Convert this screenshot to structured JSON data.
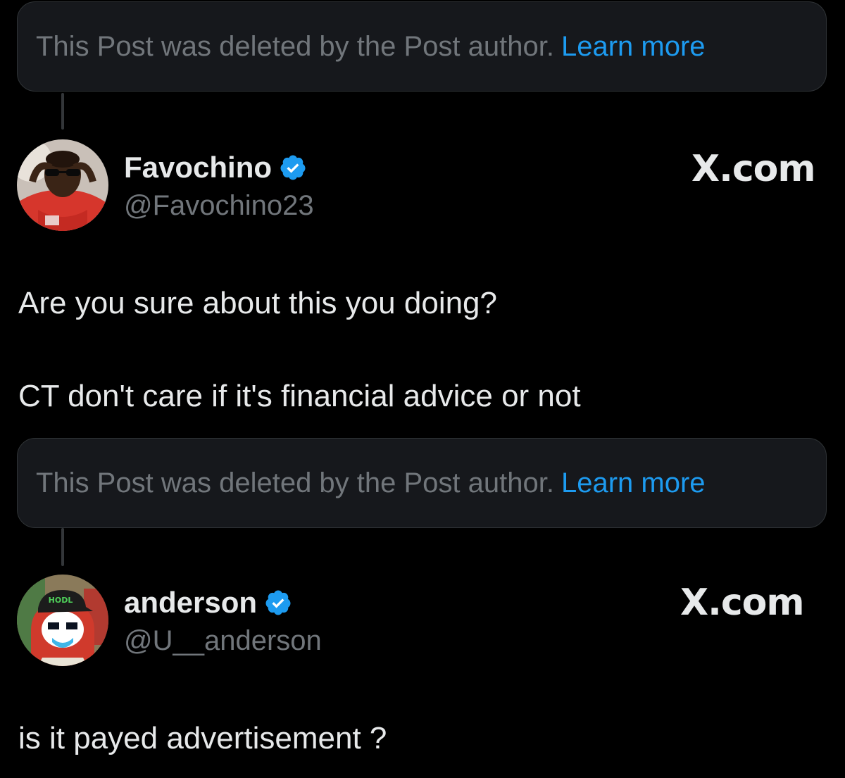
{
  "deleted_notice": {
    "text": "This Post was deleted by the Post author.",
    "link": "Learn more"
  },
  "posts": [
    {
      "display_name": "Favochino",
      "handle": "@Favochino23",
      "brand": "X.com",
      "verified": true,
      "lines": [
        "Are you sure about this you doing?",
        "CT don't care if it's financial advice or not"
      ]
    },
    {
      "display_name": "anderson",
      "handle": "@U__anderson",
      "brand": "X.com",
      "verified": true,
      "cap_text": "HODL",
      "lines": [
        "is it payed advertisement ?"
      ]
    }
  ],
  "colors": {
    "background": "#000000",
    "card": "#16181c",
    "muted": "#71767b",
    "link": "#1d9bf0",
    "text": "#e7e9ea"
  },
  "icons": {
    "verified": "verified-badge-icon"
  }
}
